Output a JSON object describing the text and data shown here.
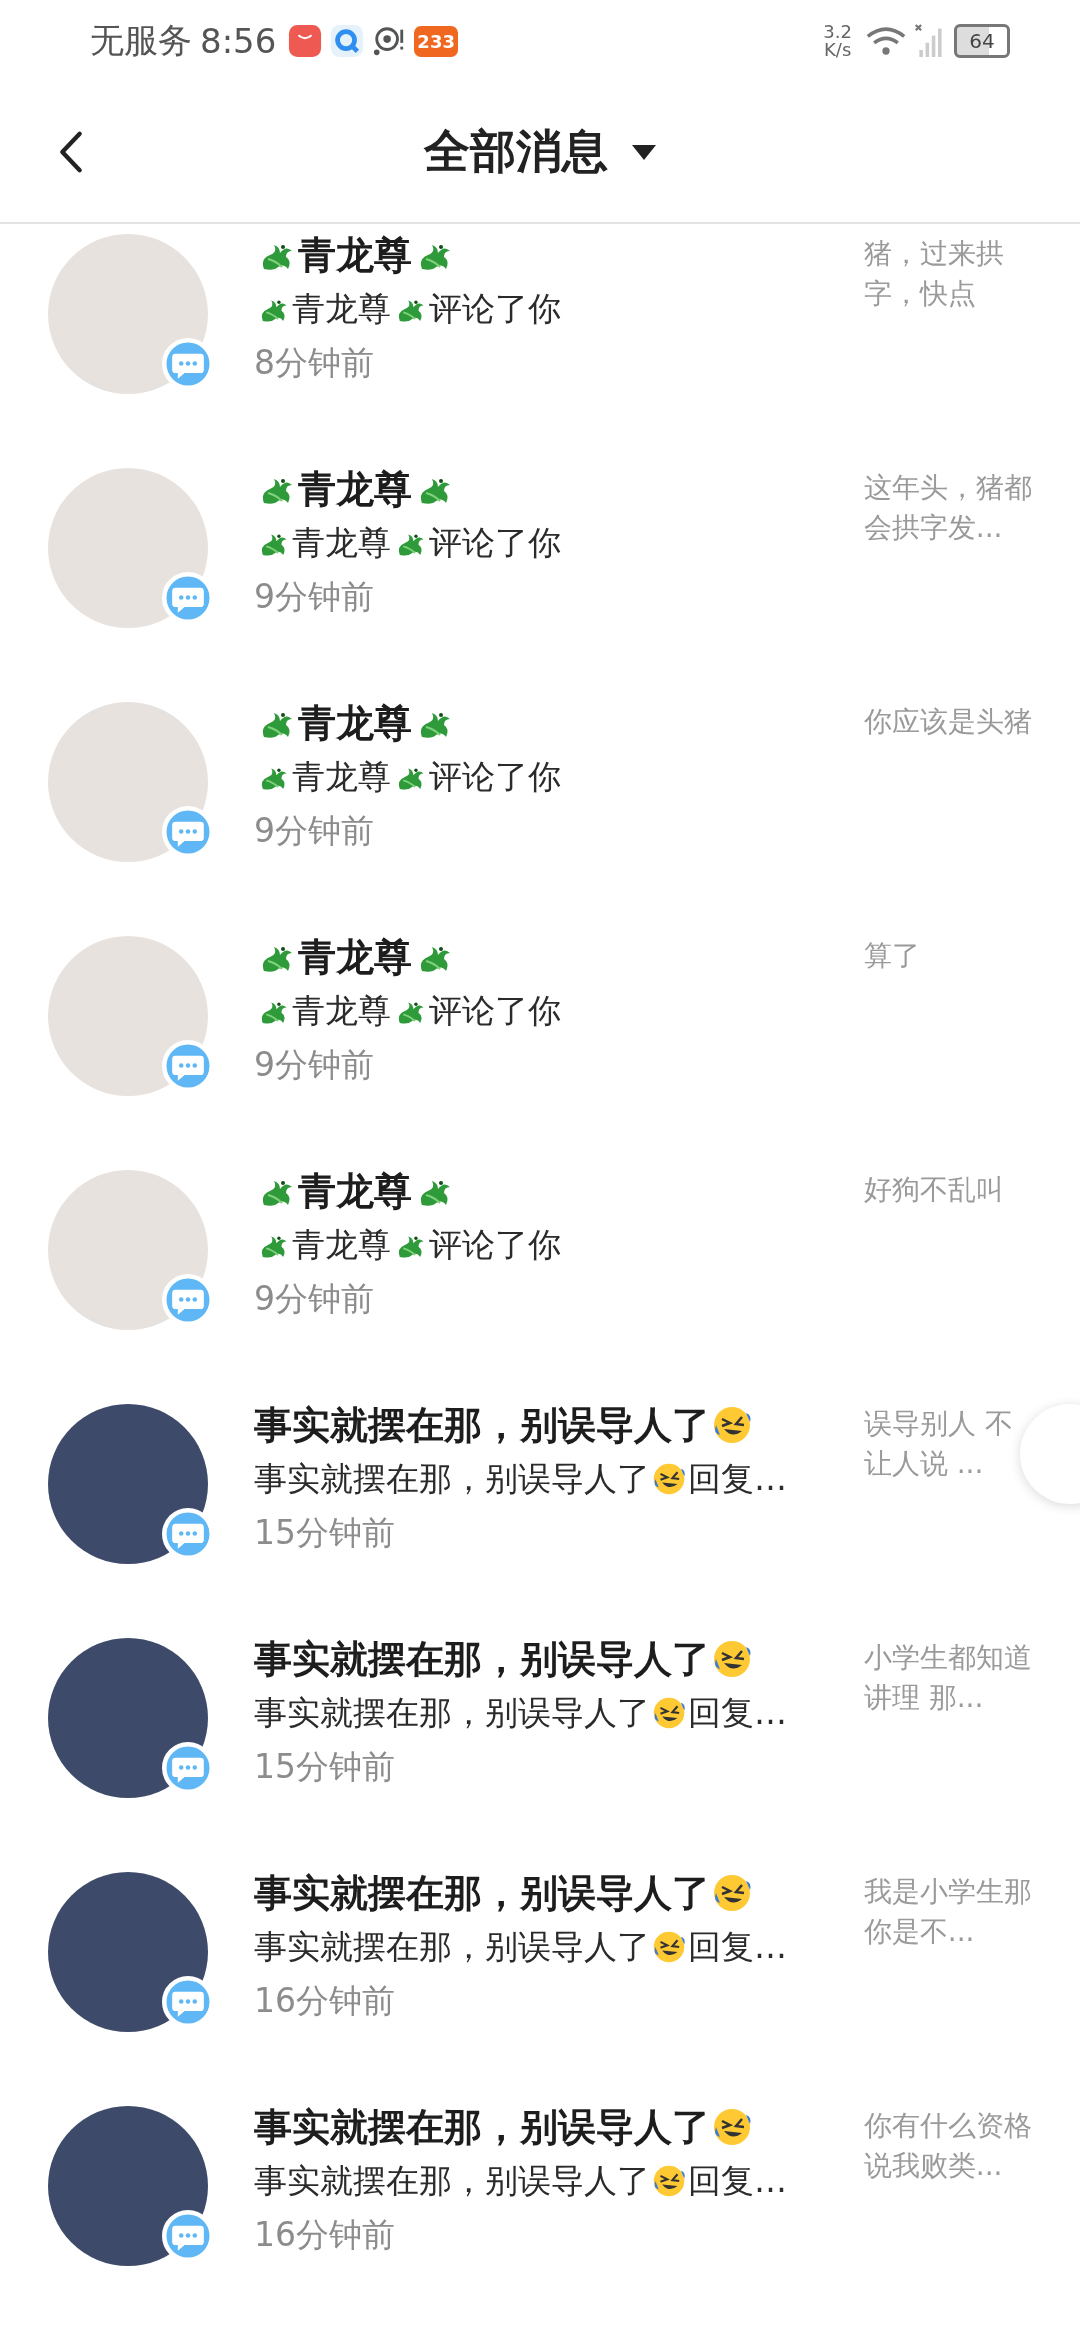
{
  "status_bar": {
    "carrier": "无服务",
    "time": "8:56",
    "app_badge": "233",
    "speed_value": "3.2",
    "speed_unit": "K/s",
    "battery": "64"
  },
  "header": {
    "title": "全部消息"
  },
  "messages": [
    {
      "kind": "portrait",
      "name": [
        {
          "kind": "dragon"
        },
        {
          "kind": "text",
          "text": "青龙尊"
        },
        {
          "kind": "dragon"
        }
      ],
      "summary": [
        {
          "kind": "dragon"
        },
        {
          "kind": "text",
          "text": "青龙尊"
        },
        {
          "kind": "dragon"
        },
        {
          "kind": "text",
          "text": "评论了你"
        }
      ],
      "time": "8分钟前",
      "preview": "猪，过来拱字，快点"
    },
    {
      "kind": "portrait",
      "name": [
        {
          "kind": "dragon"
        },
        {
          "kind": "text",
          "text": "青龙尊"
        },
        {
          "kind": "dragon"
        }
      ],
      "summary": [
        {
          "kind": "dragon"
        },
        {
          "kind": "text",
          "text": "青龙尊"
        },
        {
          "kind": "dragon"
        },
        {
          "kind": "text",
          "text": "评论了你"
        }
      ],
      "time": "9分钟前",
      "preview": "这年头，猪都会拱字发..."
    },
    {
      "kind": "portrait",
      "name": [
        {
          "kind": "dragon"
        },
        {
          "kind": "text",
          "text": "青龙尊"
        },
        {
          "kind": "dragon"
        }
      ],
      "summary": [
        {
          "kind": "dragon"
        },
        {
          "kind": "text",
          "text": "青龙尊"
        },
        {
          "kind": "dragon"
        },
        {
          "kind": "text",
          "text": "评论了你"
        }
      ],
      "time": "9分钟前",
      "preview": "你应该是头猪"
    },
    {
      "kind": "portrait",
      "name": [
        {
          "kind": "dragon"
        },
        {
          "kind": "text",
          "text": "青龙尊"
        },
        {
          "kind": "dragon"
        }
      ],
      "summary": [
        {
          "kind": "dragon"
        },
        {
          "kind": "text",
          "text": "青龙尊"
        },
        {
          "kind": "dragon"
        },
        {
          "kind": "text",
          "text": "评论了你"
        }
      ],
      "time": "9分钟前",
      "preview": "算了"
    },
    {
      "kind": "portrait",
      "name": [
        {
          "kind": "dragon"
        },
        {
          "kind": "text",
          "text": "青龙尊"
        },
        {
          "kind": "dragon"
        }
      ],
      "summary": [
        {
          "kind": "dragon"
        },
        {
          "kind": "text",
          "text": "青龙尊"
        },
        {
          "kind": "dragon"
        },
        {
          "kind": "text",
          "text": "评论了你"
        }
      ],
      "time": "9分钟前",
      "preview": "好狗不乱叫"
    },
    {
      "kind": "cartoon",
      "name": [
        {
          "kind": "text",
          "text": "事实就摆在那，别误导人了"
        },
        {
          "kind": "laugh"
        }
      ],
      "summary": [
        {
          "kind": "text",
          "text": "事实就摆在那，别误导人了"
        },
        {
          "kind": "laugh"
        },
        {
          "kind": "text",
          "text": "回复…"
        }
      ],
      "time": "15分钟前",
      "preview": "误导别人 不让人说 ..."
    },
    {
      "kind": "cartoon",
      "name": [
        {
          "kind": "text",
          "text": "事实就摆在那，别误导人了"
        },
        {
          "kind": "laugh"
        }
      ],
      "summary": [
        {
          "kind": "text",
          "text": "事实就摆在那，别误导人了"
        },
        {
          "kind": "laugh"
        },
        {
          "kind": "text",
          "text": "回复…"
        }
      ],
      "time": "15分钟前",
      "preview": "小学生都知道讲理 那..."
    },
    {
      "kind": "cartoon",
      "name": [
        {
          "kind": "text",
          "text": "事实就摆在那，别误导人了"
        },
        {
          "kind": "laugh"
        }
      ],
      "summary": [
        {
          "kind": "text",
          "text": "事实就摆在那，别误导人了"
        },
        {
          "kind": "laugh"
        },
        {
          "kind": "text",
          "text": "回复…"
        }
      ],
      "time": "16分钟前",
      "preview": "我是小学生那你是不..."
    },
    {
      "kind": "cartoon",
      "name": [
        {
          "kind": "text",
          "text": "事实就摆在那，别误导人了"
        },
        {
          "kind": "laugh"
        }
      ],
      "summary": [
        {
          "kind": "text",
          "text": "事实就摆在那，别误导人了"
        },
        {
          "kind": "laugh"
        },
        {
          "kind": "text",
          "text": "回复…"
        }
      ],
      "time": "16分钟前",
      "preview": "你有什么资格说我败类..."
    }
  ]
}
